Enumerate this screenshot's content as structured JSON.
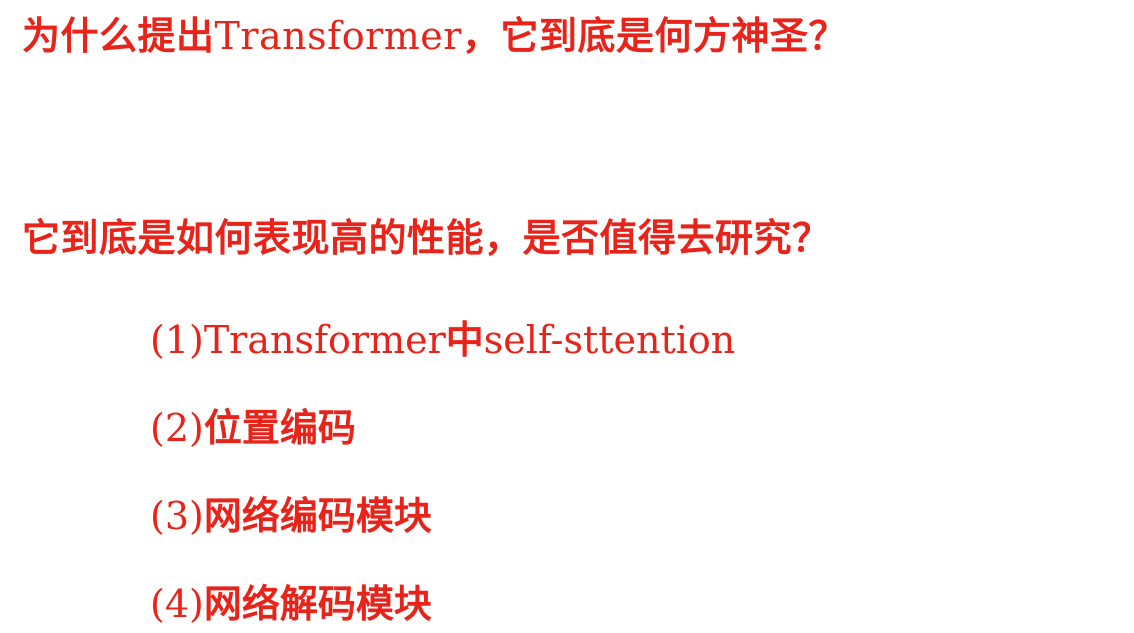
{
  "colors": {
    "text_red": "#e8231a",
    "background": "#ffffff"
  },
  "question1": {
    "part_a": "为什么提出",
    "part_b": "Transformer",
    "part_c": "，它到底是何方神圣？"
  },
  "question2": {
    "text": "它到底是如何表现高的性能，是否值得去研究？"
  },
  "items": [
    {
      "number": "(1)",
      "text_a": "Transformer",
      "text_b": "中",
      "text_c": "self-sttention"
    },
    {
      "number": "(2)",
      "text": "位置编码"
    },
    {
      "number": "(3)",
      "text": "网络编码模块"
    },
    {
      "number": "(4)",
      "text": "网络解码模块"
    }
  ]
}
